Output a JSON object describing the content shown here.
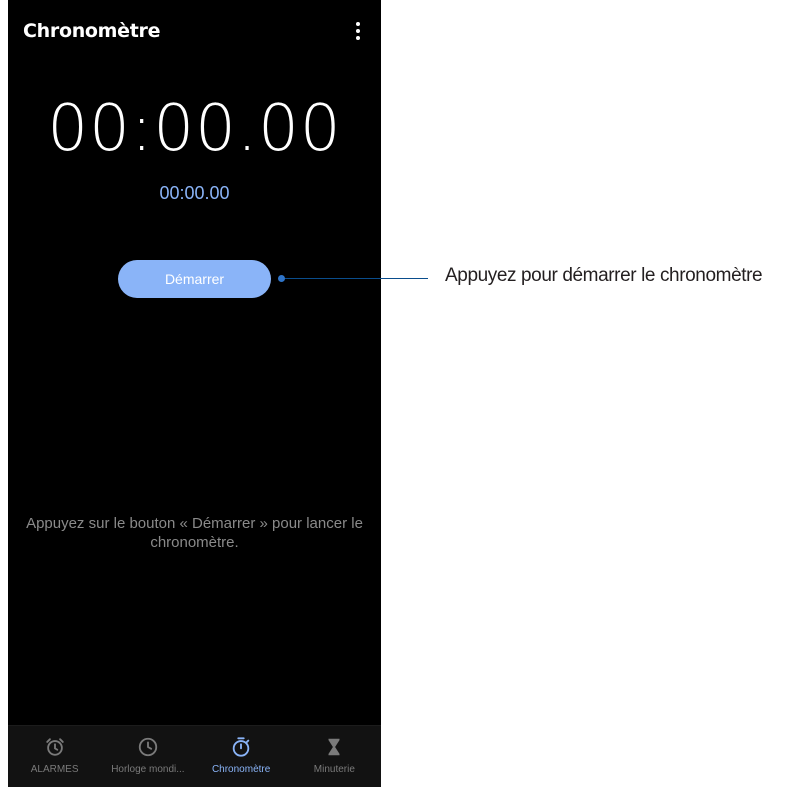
{
  "app": {
    "title": "Chronomètre",
    "menu_icon": "more-vert-icon"
  },
  "stopwatch": {
    "main_time": "00:00.00",
    "lap_time": "00:00.00",
    "start_label": "Démarrer",
    "hint": "Appuyez sur le bouton « Démarrer » pour lancer le chronomètre."
  },
  "nav": {
    "items": [
      {
        "label": "ALARMES",
        "icon": "alarm-icon",
        "active": false
      },
      {
        "label": "Horloge mondi...",
        "icon": "clock-icon",
        "active": false
      },
      {
        "label": "Chronomètre",
        "icon": "stopwatch-icon",
        "active": true
      },
      {
        "label": "Minuterie",
        "icon": "hourglass-icon",
        "active": false
      }
    ]
  },
  "annotation": {
    "text": "Appuyez pour démarrer le chronomètre"
  },
  "colors": {
    "accent": "#8ab4f8",
    "background": "#000000",
    "callout": "#2f74c8"
  }
}
